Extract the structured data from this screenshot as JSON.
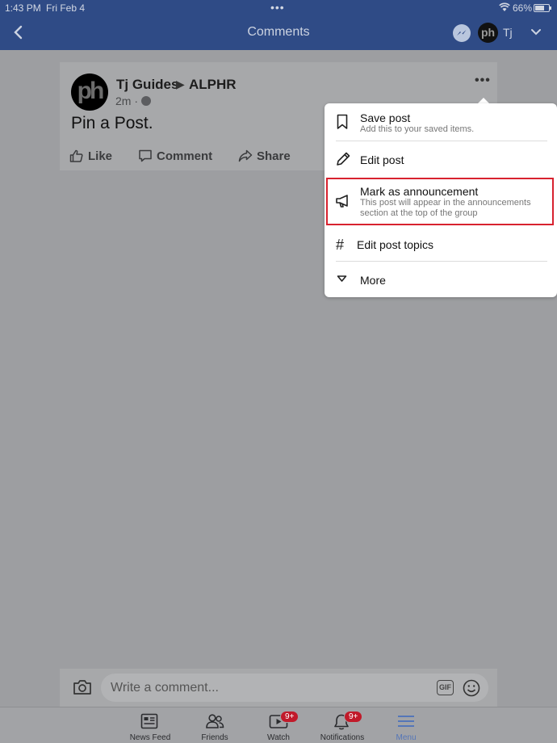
{
  "status_bar": {
    "time": "1:43 PM",
    "date": "Fri Feb 4",
    "battery": "66%"
  },
  "nav": {
    "title": "Comments",
    "user_name": "Tj",
    "avatar_text": "ph"
  },
  "post": {
    "avatar_text": "ph",
    "author": "Tj Guides",
    "arrow": "▶",
    "group": "ALPHR",
    "timestamp": "2m ·",
    "text": "Pin a Post.",
    "more": "•••",
    "actions": {
      "like": "Like",
      "comment": "Comment",
      "share": "Share"
    }
  },
  "menu": {
    "items": [
      {
        "label": "Save post",
        "sub": "Add this to your saved items.",
        "icon": "bookmark-icon"
      },
      {
        "label": "Edit post",
        "icon": "pencil-icon"
      },
      {
        "label": "Mark as announcement",
        "sub": "This post will appear in the announcements section at the top of the group",
        "icon": "megaphone-icon"
      },
      {
        "label": "Edit post topics",
        "icon": "hashtag-icon"
      },
      {
        "label": "More",
        "icon": "chevron-down-icon"
      }
    ]
  },
  "comment_bar": {
    "placeholder": "Write a comment...",
    "gif_label": "GIF"
  },
  "tabs": [
    {
      "label": "News Feed",
      "icon": "news-feed-icon"
    },
    {
      "label": "Friends",
      "icon": "friends-icon"
    },
    {
      "label": "Watch",
      "icon": "watch-icon",
      "badge": "9+"
    },
    {
      "label": "Notifications",
      "icon": "bell-icon",
      "badge": "9+"
    },
    {
      "label": "Menu",
      "icon": "hamburger-icon",
      "active": true
    }
  ],
  "colors": {
    "nav_blue": "#2f4b86",
    "highlight_red": "#d8222f",
    "badge_red": "#c11a2a",
    "active_tab": "#5576b8"
  }
}
